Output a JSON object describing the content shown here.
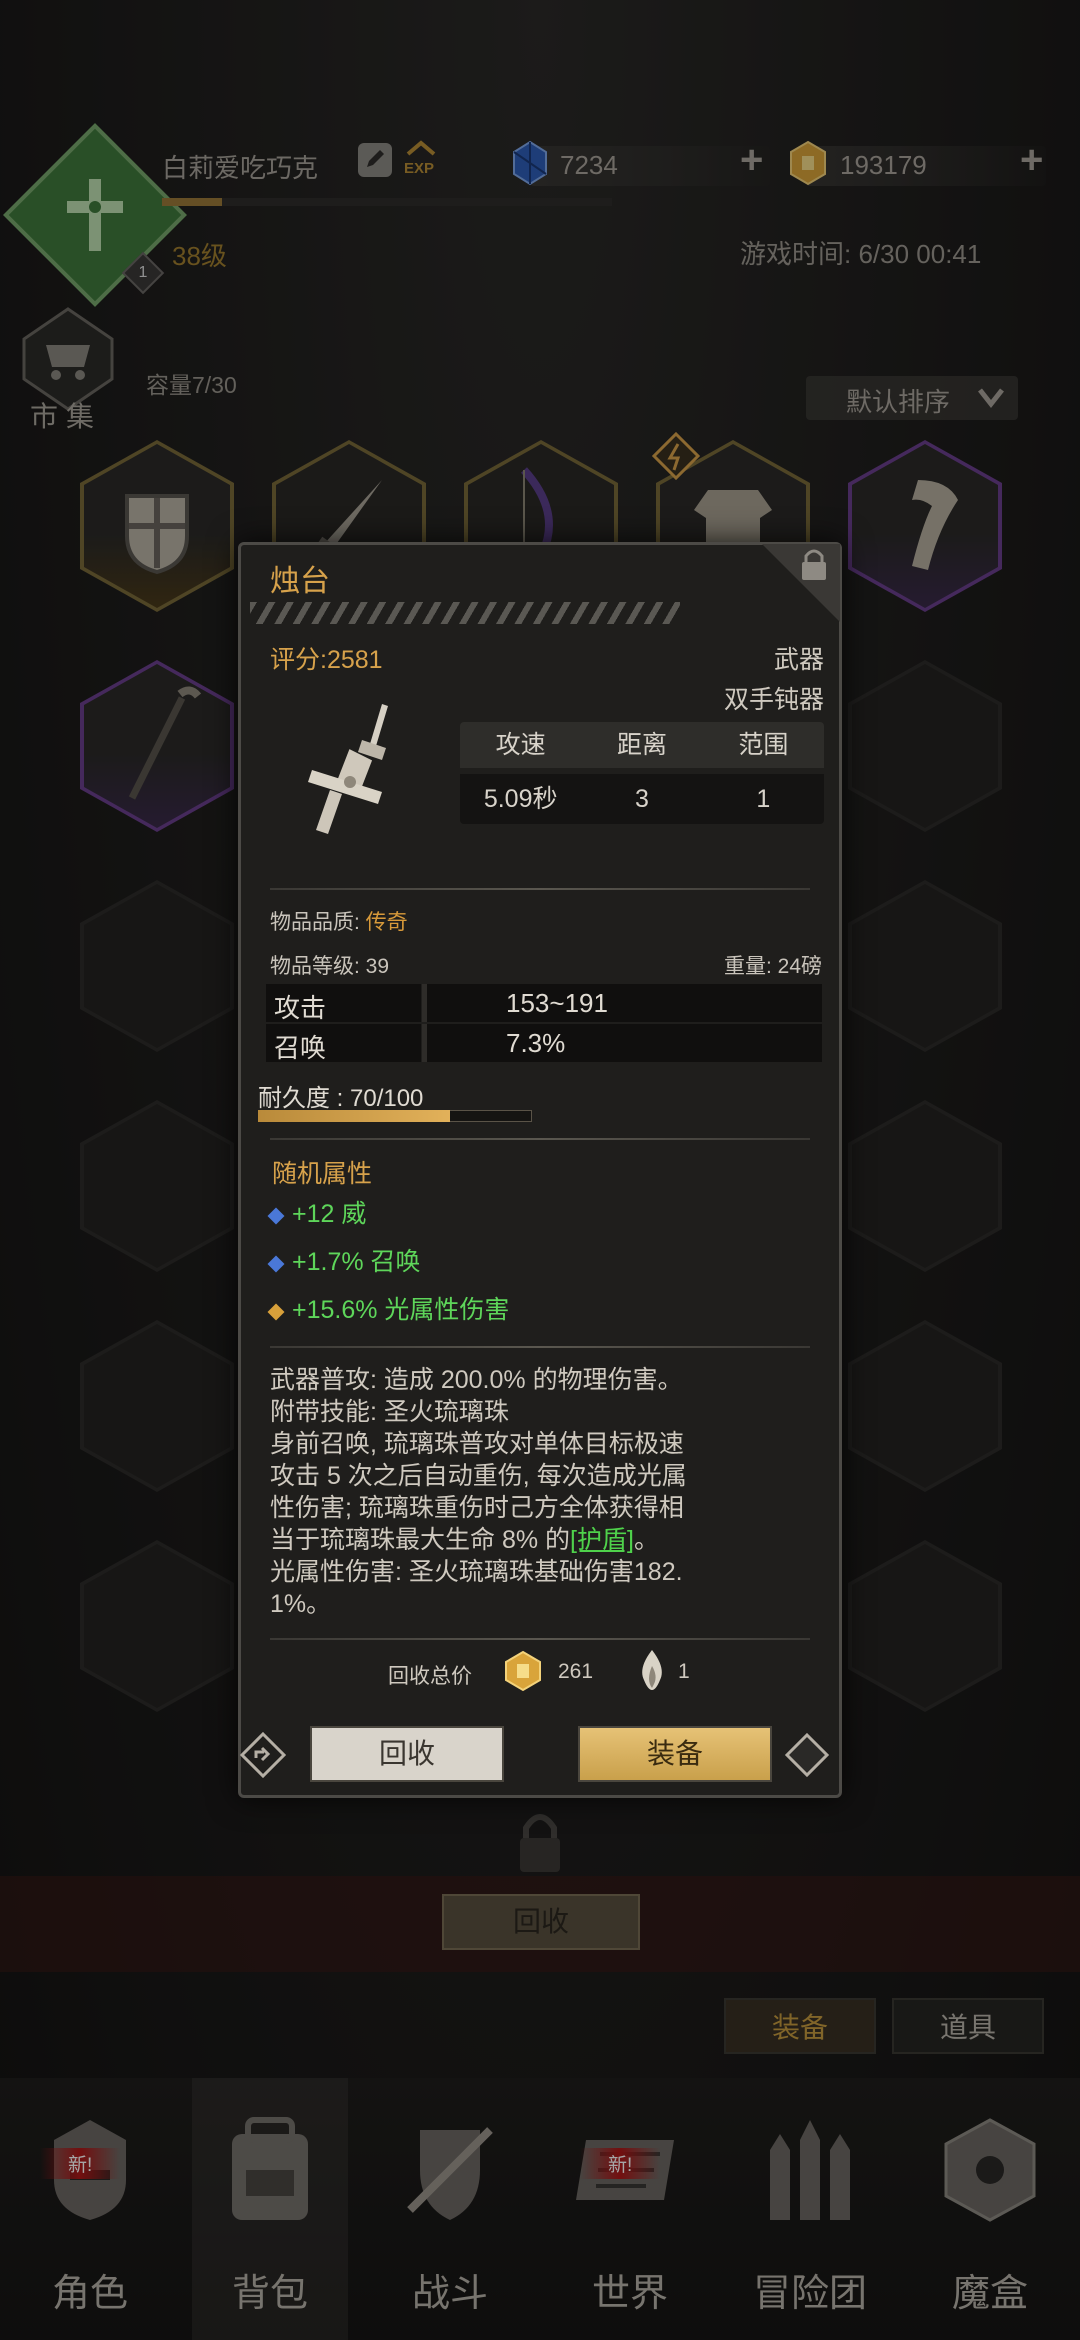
{
  "header": {
    "player_name": "白莉爱吃巧克",
    "level": "38级",
    "exp_label": "EXP",
    "rank_badge": "1",
    "blue_gem": "7234",
    "gold": "193179",
    "game_time": "游戏时间: 6/30 00:41"
  },
  "market": {
    "label": "市集",
    "capacity": "容量7/30",
    "sort_label": "默认排序"
  },
  "item_popup": {
    "name": "烛台",
    "score": "评分:2581",
    "type": "武器",
    "subtype": "双手钝器",
    "stats_header": [
      "攻速",
      "距离",
      "范围"
    ],
    "stats_values": [
      "5.09秒",
      "3",
      "1"
    ],
    "quality_label": "物品品质: ",
    "quality_value": "传奇",
    "item_level": "物品等级: 39",
    "weight": "重量: 24磅",
    "attributes": [
      {
        "label": "攻击",
        "value": "153~191"
      },
      {
        "label": "召唤",
        "value": "7.3%"
      }
    ],
    "durability_label": "耐久度 : 70/100",
    "durability_fraction": 0.7,
    "random_title": "随机属性",
    "random_attrs": [
      {
        "text": "+12 威",
        "gem": "#4a78d8"
      },
      {
        "text": "+1.7% 召唤",
        "gem": "#4a78d8"
      },
      {
        "text": "+15.6% 光属性伤害",
        "gem": "#d8a03a"
      }
    ],
    "desc_lines": [
      "武器普攻: 造成 200.0% 的物理伤害。",
      "附带技能: 圣火琉璃珠",
      "身前召唤, 琉璃珠普攻对单体目标极速",
      "攻击 5 次之后自动重伤, 每次造成光属",
      "性伤害; 琉璃珠重伤时己方全体获得相"
    ],
    "desc_line6_prefix": "当于琉璃珠最大生命 8% 的",
    "desc_line6_link": "[护盾]",
    "desc_line6_suffix": "。",
    "desc_line7": "光属性伤害: 圣火琉璃珠基础伤害182.",
    "desc_line8": "1%。",
    "recycle_total_label": "回收总价",
    "recycle_coins": "261",
    "recycle_flames": "1",
    "btn_recycle": "回收",
    "btn_equip": "装备"
  },
  "bottom": {
    "recycle_button": "回收",
    "tab_equip": "装备",
    "tab_item": "道具",
    "nav": [
      {
        "label": "角色",
        "badge": "新!"
      },
      {
        "label": "背包",
        "badge": ""
      },
      {
        "label": "战斗",
        "badge": ""
      },
      {
        "label": "世界",
        "badge": "新!"
      },
      {
        "label": "冒险团",
        "badge": ""
      },
      {
        "label": "魔盒",
        "badge": ""
      }
    ]
  },
  "colors": {
    "accent_gold": "#d7a24b",
    "legendary": "#d89a3a",
    "positive_green": "#5ed65a",
    "panel_bg": "#1f1e1c"
  }
}
